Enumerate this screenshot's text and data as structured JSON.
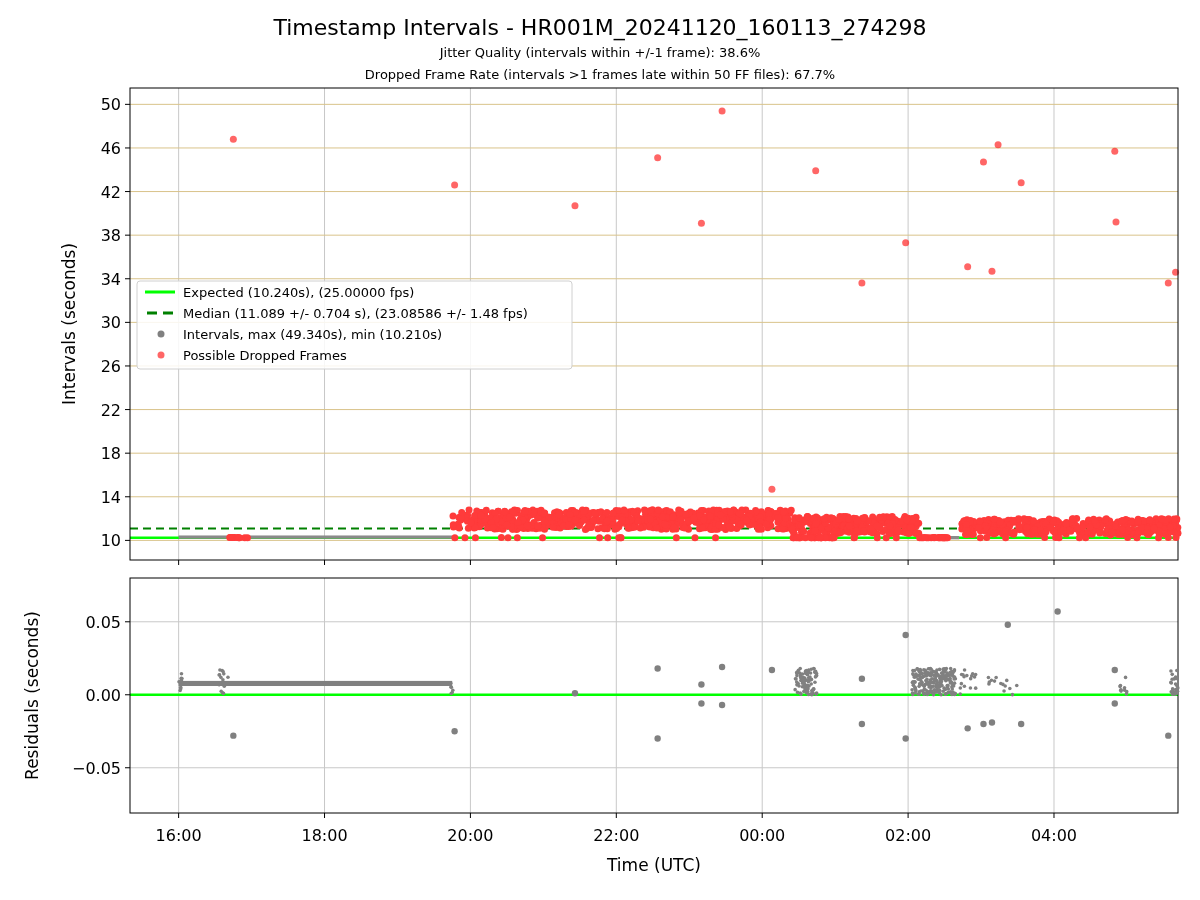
{
  "figure": {
    "title": "Timestamp Intervals - HR001M_20241120_160113_274298",
    "subtitles": [
      "Jitter Quality (intervals within +/-1 frame): 38.6%",
      "Dropped Frame Rate (intervals >1 frames late within 50 FF files): 67.7%"
    ]
  },
  "intervals_plot": {
    "legend": [
      {
        "kind": "line",
        "label": "Expected (10.240s), (25.00000 fps)",
        "color": "#00ff00"
      },
      {
        "kind": "dashed",
        "label": "Median (11.089 +/- 0.704 s), (23.08586 +/- 1.48 fps)",
        "color": "#008000"
      },
      {
        "kind": "dot",
        "label": "Intervals, max (49.340s), min (10.210s)",
        "color": "#808080"
      }
    ],
    "chart_data": {
      "type": "scatter",
      "ylabel": "Intervals (seconds)",
      "x": [
        "2024-11-20T16:45",
        "2024-11-20T19:47",
        "2024-11-20T21:26",
        "2024-11-20T22:34",
        "2024-11-20T23:10",
        "2024-11-20T23:27",
        "2024-11-21T00:08",
        "2024-11-21T00:44",
        "2024-11-21T01:22",
        "2024-11-21T01:58",
        "2024-11-21T02:49",
        "2024-11-21T03:02",
        "2024-11-21T03:09",
        "2024-11-21T03:14",
        "2024-11-21T03:33",
        "2024-11-21T04:50",
        "2024-11-21T04:51",
        "2024-11-21T05:34",
        "2024-11-21T05:40"
      ],
      "series": [
        {
          "name": "Possible Dropped Frames",
          "color": "#ff0000",
          "values": [
            46.8,
            42.6,
            40.7,
            45.1,
            39.1,
            49.4,
            14.7,
            43.9,
            33.6,
            37.3,
            35.1,
            44.7,
            34.7,
            46.3,
            42.8,
            45.7,
            39.2,
            33.6,
            34.6
          ]
        }
      ],
      "xlim": [
        "2024-11-20T15:20",
        "2024-11-21T05:42"
      ],
      "ylim": [
        8.2,
        51.5
      ],
      "yticks": [
        {
          "value": 10,
          "label": "10"
        },
        {
          "value": 14,
          "label": "14"
        },
        {
          "value": 18,
          "label": "18"
        },
        {
          "value": 22,
          "label": "22"
        },
        {
          "value": 26,
          "label": "26"
        },
        {
          "value": 30,
          "label": "30"
        },
        {
          "value": 34,
          "label": "34"
        },
        {
          "value": 38,
          "label": "38"
        },
        {
          "value": 42,
          "label": "42"
        },
        {
          "value": 46,
          "label": "46"
        },
        {
          "value": 50,
          "label": "50"
        }
      ],
      "grid": true,
      "ref_lines": [
        {
          "axis": "y",
          "value": 10.24
        },
        {
          "axis": "y",
          "value": 11.089
        }
      ]
    }
  },
  "residuals_plot": {
    "chart_data": {
      "type": "scatter",
      "xlabel": "Time (UTC)",
      "ylabel": "Residuals (seconds)",
      "x": [
        "2024-11-20T16:45",
        "2024-11-20T19:47",
        "2024-11-20T21:26",
        "2024-11-20T22:34",
        "2024-11-20T22:34",
        "2024-11-20T23:10",
        "2024-11-20T23:10",
        "2024-11-20T23:27",
        "2024-11-20T23:27",
        "2024-11-21T00:08",
        "2024-11-21T01:22",
        "2024-11-21T01:22",
        "2024-11-21T01:58",
        "2024-11-21T01:58",
        "2024-11-21T02:49",
        "2024-11-21T03:02",
        "2024-11-21T03:09",
        "2024-11-21T03:22",
        "2024-11-21T03:33",
        "2024-11-21T04:03",
        "2024-11-21T04:50",
        "2024-11-21T04:50",
        "2024-11-21T05:34"
      ],
      "series": [
        {
          "color": "#808080",
          "values": [
            -0.028,
            -0.025,
            0.001,
            0.018,
            -0.03,
            0.007,
            -0.006,
            0.019,
            -0.007,
            0.017,
            -0.02,
            0.011,
            0.041,
            -0.03,
            -0.023,
            -0.02,
            -0.019,
            0.048,
            -0.02,
            0.057,
            -0.006,
            0.017,
            -0.028
          ]
        }
      ],
      "xlim": [
        "2024-11-20T15:20",
        "2024-11-21T05:42"
      ],
      "ylim": [
        -0.081,
        0.08
      ],
      "xticks": [
        {
          "value": "2024-11-20T16:00",
          "label": "16:00"
        },
        {
          "value": "2024-11-20T18:00",
          "label": "18:00"
        },
        {
          "value": "2024-11-20T20:00",
          "label": "20:00"
        },
        {
          "value": "2024-11-20T22:00",
          "label": "22:00"
        },
        {
          "value": "2024-11-21T00:00",
          "label": "00:00"
        },
        {
          "value": "2024-11-21T02:00",
          "label": "02:00"
        },
        {
          "value": "2024-11-21T04:00",
          "label": "04:00"
        }
      ],
      "yticks": [
        {
          "value": -0.05,
          "label": "−0.05"
        },
        {
          "value": 0,
          "label": "0.00"
        },
        {
          "value": 0.05,
          "label": "0.05"
        }
      ],
      "grid": true,
      "ref_lines": [
        {
          "axis": "y",
          "value": 0
        }
      ]
    }
  }
}
